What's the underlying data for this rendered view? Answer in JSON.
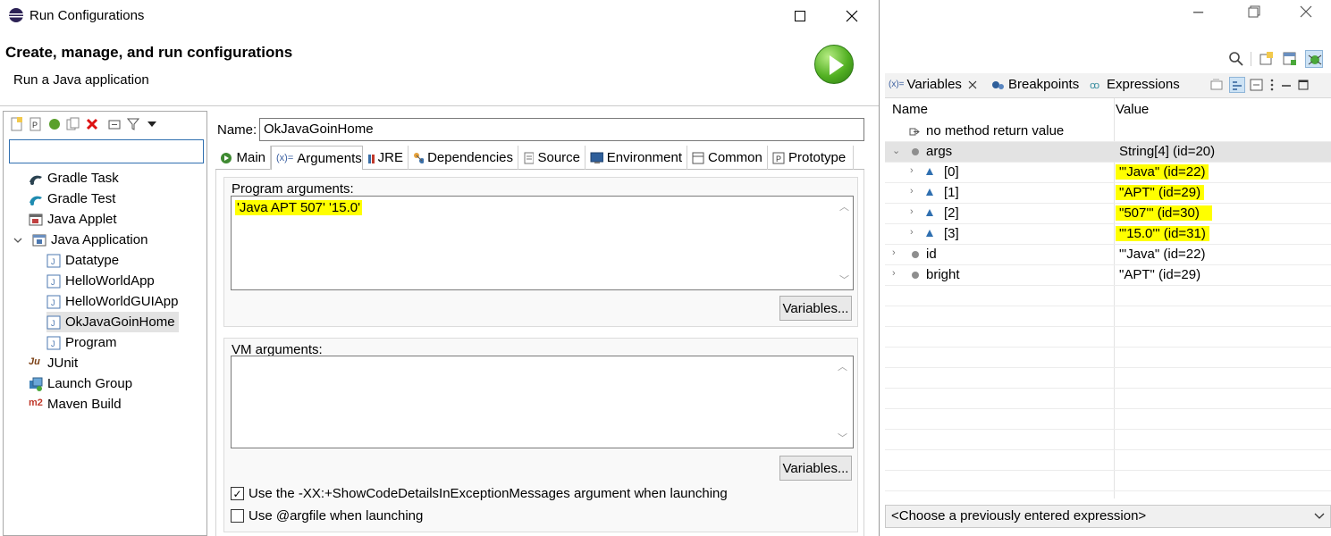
{
  "dialog": {
    "title": "Run Configurations",
    "header_title": "Create, manage, and run configurations",
    "header_subtitle": "Run a Java application",
    "window_buttons": {
      "maximize": "☐",
      "close": "✕"
    }
  },
  "tree": {
    "filter_value": "",
    "items": [
      {
        "label": "Gradle Task",
        "icon": "gradle-icon"
      },
      {
        "label": "Gradle Test",
        "icon": "gradle-icon"
      },
      {
        "label": "Java Applet",
        "icon": "applet-icon"
      },
      {
        "label": "Java Application",
        "icon": "java-app-icon"
      },
      {
        "label": "Datatype",
        "icon": "java-file-icon"
      },
      {
        "label": "HelloWorldApp",
        "icon": "java-file-icon"
      },
      {
        "label": "HelloWorldGUIApp",
        "icon": "java-file-icon"
      },
      {
        "label": "OkJavaGoinHome",
        "icon": "java-file-icon"
      },
      {
        "label": "Program",
        "icon": "java-file-icon"
      },
      {
        "label": "JUnit",
        "icon": "junit-icon",
        "glyph": "Ju"
      },
      {
        "label": "Launch Group",
        "icon": "launch-group-icon"
      },
      {
        "label": "Maven Build",
        "icon": "maven-icon",
        "glyph": "m2"
      }
    ]
  },
  "config": {
    "name_label": "Name:",
    "name_value": "OkJavaGoinHome",
    "tabs": [
      "Main",
      "Arguments",
      "JRE",
      "Dependencies",
      "Source",
      "Environment",
      "Common",
      "Prototype"
    ],
    "active_tab": "Arguments",
    "program_args_label": "Program arguments:",
    "program_args_value": "'Java APT 507' '15.0'",
    "variables_button": "Variables...",
    "vm_args_label": "VM arguments:",
    "vm_args_value": "",
    "variables_button_2": "Variables...",
    "checkbox_1": {
      "label": "Use the -XX:+ShowCodeDetailsInExceptionMessages argument when launching",
      "checked": true
    },
    "checkbox_2": {
      "label": "Use @argfile when launching",
      "checked": false
    }
  },
  "debug": {
    "tabs": [
      "Variables",
      "Breakpoints",
      "Expressions"
    ],
    "columns": [
      "Name",
      "Value"
    ],
    "rows": [
      {
        "name": "no method return value",
        "value": ""
      },
      {
        "name": "args",
        "value": "String[4]  (id=20)"
      },
      {
        "name": "[0]",
        "value": "\"'Java\" (id=22)"
      },
      {
        "name": "[1]",
        "value": "\"APT\" (id=29)"
      },
      {
        "name": "[2]",
        "value": "\"507'\" (id=30)"
      },
      {
        "name": "[3]",
        "value": "\"'15.0'\" (id=31)"
      },
      {
        "name": "id",
        "value": "\"'Java\" (id=22)"
      },
      {
        "name": "bright",
        "value": "\"APT\" (id=29)"
      }
    ],
    "expression_placeholder": "<Choose a previously entered expression>"
  },
  "colors": {
    "highlight": "#ffff00",
    "selection": "#e3e3e3",
    "accent": "#2f6fb0"
  }
}
